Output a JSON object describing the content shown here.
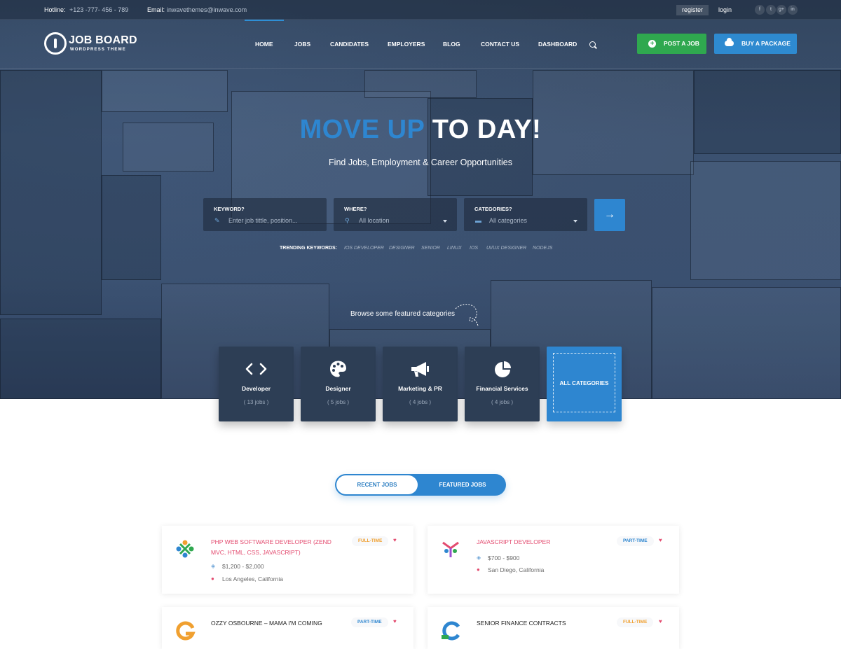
{
  "topbar": {
    "hotline_label": "Hotline:",
    "hotline_value": "+123 -777- 456 - 789",
    "email_label": "Email:",
    "email_value": "inwavethemes@inwave.com",
    "register": "register",
    "login": "login",
    "social": [
      "f",
      "t",
      "g+",
      "in"
    ]
  },
  "logo": {
    "name": "JOB BOARD",
    "sub": "WORDPRESS THEME"
  },
  "nav": [
    "HOME",
    "JOBS",
    "CANDIDATES",
    "EMPLOYERS",
    "BLOG",
    "CONTACT US",
    "DASHBOARD"
  ],
  "header_buttons": {
    "post": "POST A JOB",
    "package": "BUY A PACKAGE"
  },
  "hero": {
    "title_blue": "MOVE UP",
    "title_white": "TO DAY!",
    "subtitle": "Find Jobs, Employment & Career Opportunities"
  },
  "search": {
    "keyword_label": "KEYWORD?",
    "keyword_placeholder": "Enter job tittle, position...",
    "where_label": "WHERE?",
    "where_value": "All location",
    "categories_label": "CATEGORIES?",
    "categories_value": "All categories"
  },
  "trending": {
    "label": "TRENDING KEYWORDS:",
    "keywords": [
      "IOS DEVELOPER",
      "DESIGNER",
      "SENIOR",
      "LINUX",
      "IOS",
      "UI/UX DESIGNER",
      "NODEJS"
    ]
  },
  "browse_text": "Browse some featured categories",
  "categories": [
    {
      "name": "Developer",
      "count": "( 13 jobs )",
      "icon": "code-icon"
    },
    {
      "name": "Designer",
      "count": "( 5 jobs )",
      "icon": "palette-icon"
    },
    {
      "name": "Marketing & PR",
      "count": "( 4 jobs )",
      "icon": "megaphone-icon"
    },
    {
      "name": "Financial Services",
      "count": "( 4 jobs )",
      "icon": "pie-chart-icon"
    }
  ],
  "all_categories": "ALL CATEGORIES",
  "tabs": {
    "recent": "RECENT JOBS",
    "featured": "FEATURED JOBS"
  },
  "jobs": [
    {
      "title": "PHP WEB SOFTWARE DEVELOPER (ZEND MVC, HTML, CSS, JAVASCRIPT)",
      "type": "FULL-TIME",
      "salary": "$1,200 - $2,000",
      "location": "Los Angeles, California",
      "type_color": "#f0a030"
    },
    {
      "title": "JAVASCRIPT DEVELOPER",
      "type": "PART-TIME",
      "salary": "$700 - $900",
      "location": "San Diego, California",
      "type_color": "#2e86d0"
    },
    {
      "title": "OZZY OSBOURNE – MAMA I'M COMING",
      "type": "PART-TIME",
      "type_color": "#2e86d0"
    },
    {
      "title": "SENIOR FINANCE CONTRACTS",
      "type": "FULL-TIME",
      "type_color": "#f0a030"
    }
  ],
  "colors": {
    "accent_blue": "#2e86d0",
    "green": "#2fa84f",
    "pink": "#e34b6f"
  }
}
